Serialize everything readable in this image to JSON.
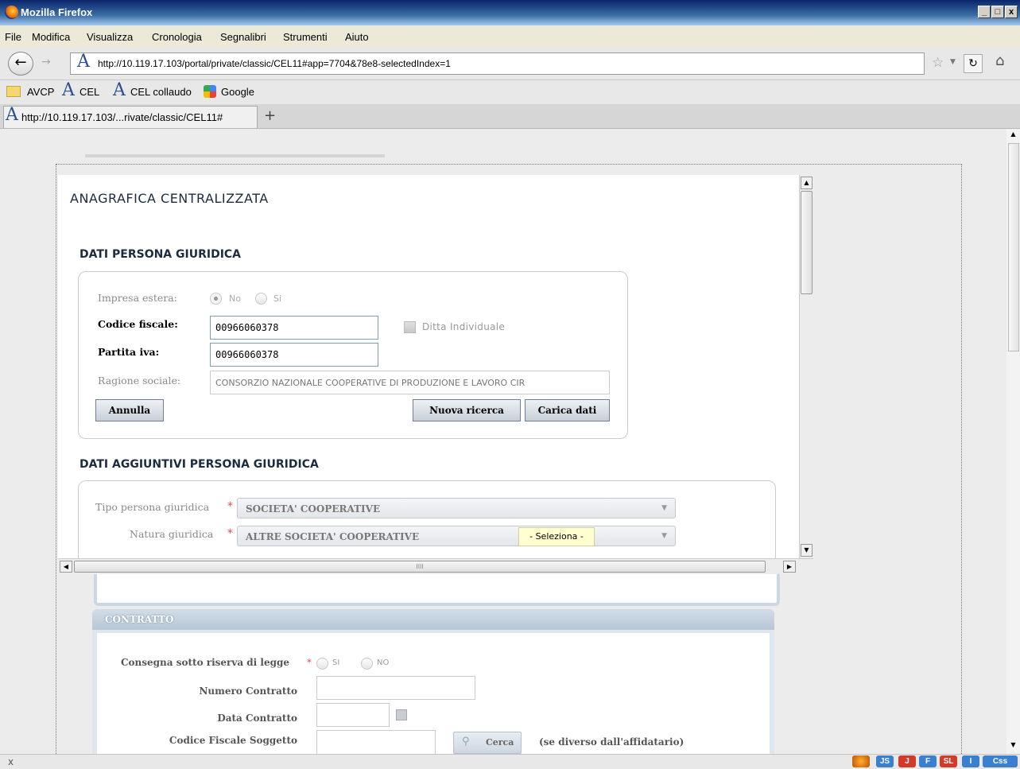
{
  "window": {
    "title": "Mozilla Firefox",
    "controls": [
      "_",
      "·",
      "x"
    ]
  },
  "menu": [
    "File",
    "Modifica",
    "Visualizza",
    "Cronologia",
    "Segnalibri",
    "Strumenti",
    "Aiuto"
  ],
  "nav": {
    "url": "http://10.119.17.103/portal/private/classic/CEL11#app=7704&78e8-selectedIndex=1"
  },
  "bookmarks": [
    "AVCP",
    "CEL",
    "CEL collaudo",
    "Google"
  ],
  "tab": {
    "title": "http://10.119.17.103/...rivate/classic/CEL11#",
    "new_tab": "+"
  },
  "dialog": {
    "title": "ANAGRAFICA CENTRALIZZATA",
    "section1": "DATI PERSONA GIURIDICA",
    "impresa_estera": {
      "label": "Impresa estera:",
      "opt_no": "No",
      "opt_si": "Si"
    },
    "codice_fiscale": {
      "label": "Codice fiscale:",
      "value": "00966060378"
    },
    "ditta_individuale": "Ditta Individuale",
    "partita_iva": {
      "label": "Partita iva:",
      "value": "00966060378"
    },
    "ragione_sociale": {
      "label": "Ragione sociale:",
      "value": "CONSORZIO NAZIONALE COOPERATIVE DI PRODUZIONE E LAVORO CIR"
    },
    "btn_annulla": "Annulla",
    "btn_nuova": "Nuova ricerca",
    "btn_carica": "Carica dati",
    "section2": "DATI AGGIUNTIVI PERSONA GIURIDICA",
    "tipo": {
      "label": "Tipo persona giuridica",
      "value": "SOCIETA' COOPERATIVE"
    },
    "natura": {
      "label": "Natura giuridica",
      "value": "ALTRE SOCIETA' COOPERATIVE"
    },
    "required_mark": "*",
    "tooltip": "- Seleziona -",
    "hscroll_grip": "IIII"
  },
  "background": {
    "section": "CONTRATTO",
    "consegna": {
      "label": "Consegna sotto riserva di legge",
      "opt_si": "SI",
      "opt_no": "NO"
    },
    "numero": "Numero Contratto",
    "data": "Data Contratto",
    "cf_soggetto": "Codice Fiscale Soggetto",
    "cerca": "Cerca",
    "note": "(se diverso dall'affidatario)"
  },
  "statusbar": {
    "close": "x",
    "badges": [
      "JS",
      "J",
      "F",
      "SL",
      "I",
      "Css"
    ]
  },
  "colors": {
    "titlebar": "#0a246a",
    "accent_required": "#e05050",
    "tooltip_bg": "#ffffd0"
  }
}
